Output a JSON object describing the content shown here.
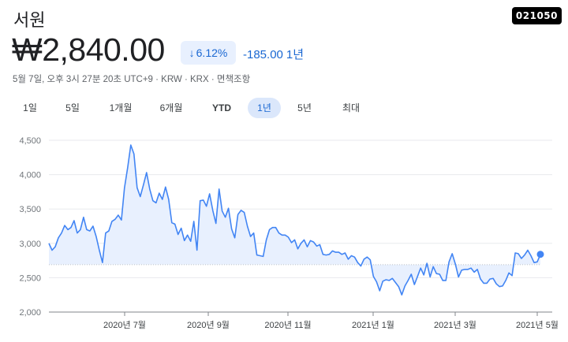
{
  "header": {
    "name": "서원",
    "ticker": "021050",
    "price": "₩2,840.00",
    "change_pct": "6.12%",
    "change_abs": "-185.00",
    "change_period": "1년",
    "meta": "5월 7일, 오후 3시 27분 20초 UTC+9 · KRW · KRX · 면책조항"
  },
  "tabs": [
    {
      "label": "1일",
      "active": false
    },
    {
      "label": "5일",
      "active": false
    },
    {
      "label": "1개월",
      "active": false
    },
    {
      "label": "6개월",
      "active": false
    },
    {
      "label": "YTD",
      "active": false
    },
    {
      "label": "1년",
      "active": true
    },
    {
      "label": "5년",
      "active": false
    },
    {
      "label": "최대",
      "active": false
    }
  ],
  "colors": {
    "accent": "#1967d2",
    "line": "#4285f4",
    "fill": "#e8f0fe",
    "badge_bg": "#e8f0fe"
  },
  "chart_data": {
    "type": "area",
    "ylim": [
      2000,
      4500
    ],
    "yticks": [
      "4,500",
      "4,000",
      "3,500",
      "3,000",
      "2,500",
      "2,000"
    ],
    "xticks": [
      "2020년 7월",
      "2020년 9월",
      "2020년 11월",
      "2021년 1월",
      "2021년 3월",
      "2021년 5월"
    ],
    "baseline": 2690,
    "last_value": 2840,
    "series": [
      {
        "values": [
          3000,
          2900,
          2950,
          3080,
          3150,
          3260,
          3200,
          3230,
          3330,
          3150,
          3200,
          3380,
          3200,
          3180,
          3250,
          3100,
          2900,
          2720,
          3150,
          3180,
          3320,
          3350,
          3410,
          3340,
          3810,
          4100,
          4430,
          4300,
          3810,
          3680,
          3850,
          4030,
          3790,
          3620,
          3590,
          3730,
          3640,
          3820,
          3640,
          3300,
          3280,
          3130,
          3220,
          3040,
          3120,
          3030,
          3320,
          2900,
          3620,
          3630,
          3540,
          3720,
          3480,
          3290,
          3790,
          3470,
          3380,
          3510,
          3210,
          3080,
          3420,
          3480,
          3450,
          3250,
          3100,
          3150,
          2830,
          2820,
          2810,
          3050,
          3200,
          3230,
          3230,
          3150,
          3120,
          3120,
          3090,
          3010,
          3050,
          2920,
          3000,
          3050,
          2950,
          3040,
          3020,
          2960,
          2980,
          2840,
          2830,
          2840,
          2890,
          2870,
          2870,
          2840,
          2860,
          2770,
          2820,
          2800,
          2720,
          2670,
          2770,
          2800,
          2760,
          2520,
          2440,
          2310,
          2450,
          2470,
          2460,
          2490,
          2430,
          2370,
          2250,
          2380,
          2460,
          2550,
          2400,
          2520,
          2640,
          2540,
          2710,
          2510,
          2660,
          2560,
          2550,
          2460,
          2460,
          2730,
          2850,
          2700,
          2510,
          2610,
          2620,
          2620,
          2640,
          2580,
          2620,
          2480,
          2420,
          2420,
          2480,
          2490,
          2410,
          2370,
          2380,
          2460,
          2570,
          2530,
          2860,
          2850,
          2780,
          2830,
          2900,
          2820,
          2720,
          2730,
          2840
        ]
      }
    ]
  }
}
